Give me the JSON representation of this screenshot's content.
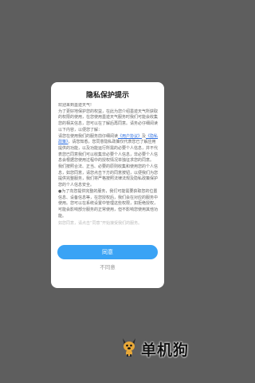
{
  "dialog": {
    "title": "隐私保护提示",
    "paragraphs": [
      "欢迎来到墨迹天气!",
      "为了更好地保护您的权益，在此为您介绍墨迹天气所获取的权限的使用，在您使用墨迹天气服务时我们可能会收集您的相关信息，您可以在了解后再同意。请务必仔细阅读以下内容，以便您了解：",
      "我们按照合法、正当、必要的原则收集和使用您的个人信息，如您同意，请您点击下方的同意按钮，以便我们为您提供完整服务，我们将严格按照法律法规及隐私政策保护您的个人信息安全。",
      "●为了向您提供完整的服务，我们可能需要获取您的位置信息、设备信息等，在您授权后，我们会在对应的服务中使用。您可以在系统设置中管理这些权限，如拒绝授权，可能会影响部分服务的正常使用，但不影响您使用其他功能。"
    ],
    "policy_intro": "请您在使用我们的服务前仔细阅读",
    "link_user_agreement": "《用户协议》",
    "link_and": "及",
    "link_privacy_policy": "《隐私政策》",
    "policy_tail": "，请您知悉，您同意隐私政策仅代表您已了解应用提供的功能，以及功能运行所需的必要个人信息，并不代表您已同意我们可以收集非必要个人信息，非必要个人信息会根据您使用过程中的授权情况单独征求您的同意。",
    "faded_text": "如您同意，请点击“同意”开始接受我们的服务。",
    "agree_label": "同意",
    "disagree_label": "不同意"
  },
  "watermark": {
    "text": "单机狗",
    "icon": "dog-mascot-icon"
  }
}
